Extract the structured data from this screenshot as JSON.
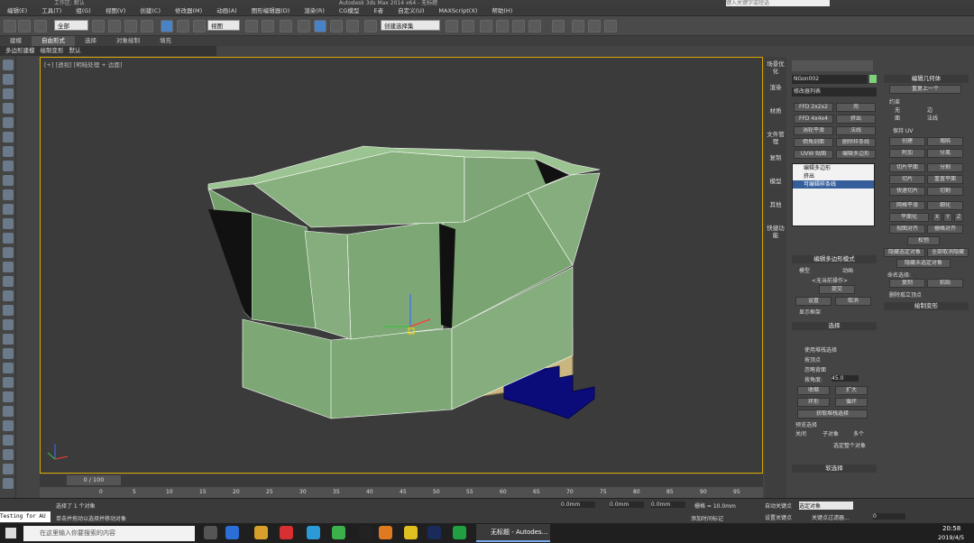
{
  "title": "Autodesk 3ds Max 2014 x64 - 无标题",
  "workspace": "工作区: 默认",
  "menu": [
    "编辑(E)",
    "工具(T)",
    "组(G)",
    "视图(V)",
    "创建(C)",
    "修改器(M)",
    "动画(A)",
    "图形编辑器(D)",
    "渲染(R)",
    "CG模型",
    "E者",
    "自定义(U)",
    "MAXScript(X)",
    "帮助(H)"
  ],
  "help_search_placeholder": "键入关键字或短语",
  "toolbar": {
    "filter": "全部",
    "view": "视图",
    "named_set": "创建选择集"
  },
  "ribbon_tabs": [
    "建模",
    "自由形式",
    "选择",
    "对象绘制",
    "填充"
  ],
  "ribbon_sub": [
    "多边形建模",
    "绘制变形",
    "默认"
  ],
  "viewport_label": "[+] [透视] [明暗处理 + 边面]",
  "side_tabs": [
    "场景优化",
    "渲染",
    "材质",
    "文件管理",
    "复制",
    "模型",
    "其他",
    "快捷功能"
  ],
  "object_name": "NGon002",
  "modifier_list": "修改器列表",
  "mod_buttons": [
    [
      "FFD 2x2x2",
      "壳"
    ],
    [
      "FFD 4x4x4",
      "挤出"
    ],
    [
      "涡轮平滑",
      "法线"
    ],
    [
      "倒角剖面",
      "删除样条线"
    ],
    [
      "UVW 贴图",
      "编辑多边形"
    ]
  ],
  "stack": [
    "编辑多边形",
    "挤出",
    "可编辑样条线"
  ],
  "edit_poly_mode": {
    "title": "编辑多边形模式",
    "model": "模型",
    "animate": "动画",
    "no_op": "<无当前操作>",
    "commit": "提交",
    "settings": "设置",
    "cancel": "取消",
    "show_cage": "显示框架"
  },
  "selection": {
    "title": "选择",
    "use_stack": "使用堆栈选择",
    "by_vertex": "按顶点",
    "ignore_back": "忽略背面",
    "by_angle": "按角度:",
    "angle": "45.0",
    "shrink": "收缩",
    "grow": "扩大",
    "ring": "环形",
    "loop": "循环",
    "get_stack": "获取堆栈选择",
    "preview": "预览选择",
    "off": "关闭",
    "subobj": "子对象",
    "multi": "多个",
    "whole": "选定整个对象",
    "soft": "软选择"
  },
  "edit_geometry": {
    "title": "编辑几何体",
    "repeat": "重复上一个",
    "constraints": "约束",
    "none": "无",
    "edge": "边",
    "face": "面",
    "normal": "法线",
    "preserve_uv": "保持 UV",
    "create": "创建",
    "collapse": "塌陷",
    "attach": "附加",
    "detach": "分离",
    "slice_plane": "切片平面",
    "split": "分割",
    "slice": "切片",
    "reset_plane": "重置平面",
    "quickslice": "快速切片",
    "cut": "切割",
    "meshsmooth": "网格平滑",
    "tessellate": "细化",
    "planarize": "平面化",
    "x": "X",
    "y": "Y",
    "z": "Z",
    "view_align": "视图对齐",
    "grid_align": "栅格对齐",
    "relax": "松弛",
    "hide_sel": "隐藏选定对象",
    "unhide_all": "全部取消隐藏",
    "hide_unsel": "隐藏未选定对象",
    "named_sel": "命名选择:",
    "copy": "复制",
    "paste": "粘贴",
    "delete_iso": "删除孤立顶点",
    "paint_deform": "绘制变形"
  },
  "time": {
    "frame": "0 / 100",
    "ticks": [
      "0",
      "5",
      "10",
      "15",
      "20",
      "25",
      "30",
      "35",
      "40",
      "45",
      "50",
      "55",
      "60",
      "65",
      "70",
      "75",
      "80",
      "85",
      "90",
      "95",
      "100"
    ]
  },
  "status": {
    "selected": "选择了 1 个对象",
    "hint": "单击并拖动以选择并移动对象",
    "x": "0.0mm",
    "y": "0.0mm",
    "z": "0.0mm",
    "grid": "栅格 = 10.0mm",
    "autokey": "自动关键点",
    "setkey": "设置关键点",
    "selobj": "选定对象",
    "keyfilter": "关键点过滤器...",
    "add_tag": "添加时间标记",
    "frame_no": "0",
    "test": "Testing for AU"
  },
  "taskbar": {
    "search": "在这里输入你要搜索的内容",
    "app": "无标题 - Autodes...",
    "clock": "20:58",
    "date": "2019/4/5"
  },
  "colors": {
    "ui_bg": "#444444",
    "viewport": "#3b3b3b",
    "mesh_green": "#7ea776",
    "mesh_base": "#c9b680",
    "stairs": "#0b0b7a",
    "accent": "#d9a800"
  }
}
